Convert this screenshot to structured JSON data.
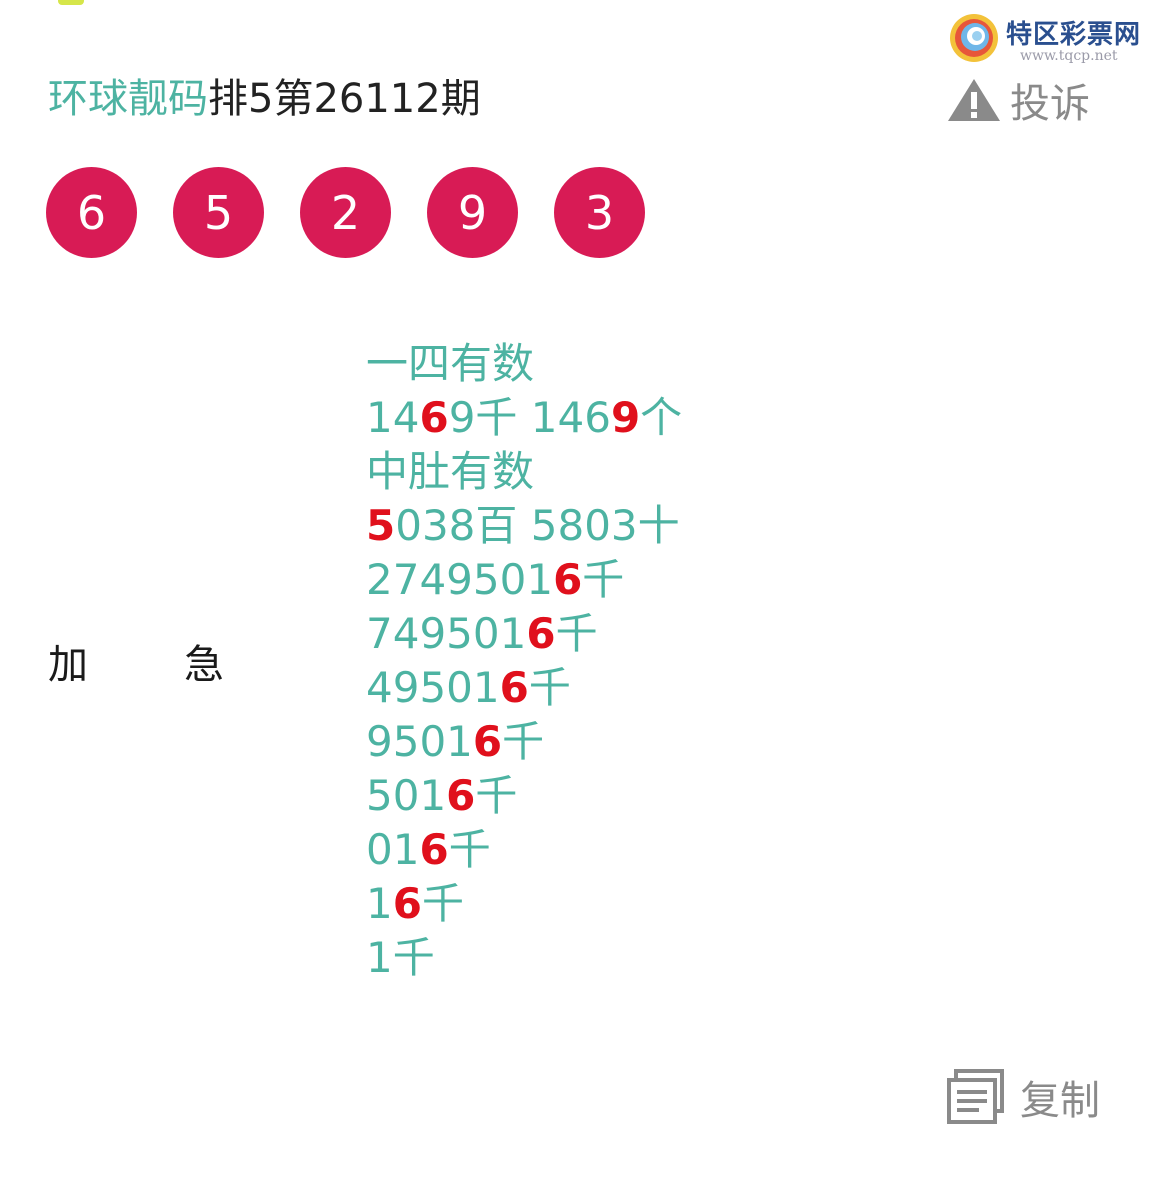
{
  "colors": {
    "brand_teal": "#4db3a2",
    "highlight_red": "#e0101c",
    "ball_red": "#d81b55",
    "icon_gray": "#8a8a8a"
  },
  "watermark": {
    "name": "特区彩票网",
    "url": "www.tqcp.net",
    "icon": "tqcp-logo-icon"
  },
  "header": {
    "brand": "环球靓码",
    "issue": "排5第26112期",
    "report_label": "投诉",
    "report_icon": "warning-triangle-icon"
  },
  "balls": [
    "6",
    "5",
    "2",
    "9",
    "3"
  ],
  "side_labels": [
    "加",
    "急"
  ],
  "content_lines": [
    [
      {
        "t": "一四有数"
      }
    ],
    [
      {
        "t": "14"
      },
      {
        "t": "6",
        "hl": true
      },
      {
        "t": "9千 146"
      },
      {
        "t": "9",
        "hl": true
      },
      {
        "t": "个"
      }
    ],
    [
      {
        "t": "中肚有数"
      }
    ],
    [
      {
        "t": "5",
        "hl": true
      },
      {
        "t": "038百 5803十"
      }
    ],
    [
      {
        "t": "2749501"
      },
      {
        "t": "6",
        "hl": true
      },
      {
        "t": "千"
      }
    ],
    [
      {
        "t": "749501"
      },
      {
        "t": "6",
        "hl": true
      },
      {
        "t": "千"
      }
    ],
    [
      {
        "t": "49501"
      },
      {
        "t": "6",
        "hl": true
      },
      {
        "t": "千"
      }
    ],
    [
      {
        "t": "9501"
      },
      {
        "t": "6",
        "hl": true
      },
      {
        "t": "千"
      }
    ],
    [
      {
        "t": "501"
      },
      {
        "t": "6",
        "hl": true
      },
      {
        "t": "千"
      }
    ],
    [
      {
        "t": "01"
      },
      {
        "t": "6",
        "hl": true
      },
      {
        "t": "千"
      }
    ],
    [
      {
        "t": "1"
      },
      {
        "t": "6",
        "hl": true
      },
      {
        "t": "千"
      }
    ],
    [
      {
        "t": "1千"
      }
    ]
  ],
  "footer": {
    "copy_label": "复制",
    "copy_icon": "copy-document-icon"
  }
}
